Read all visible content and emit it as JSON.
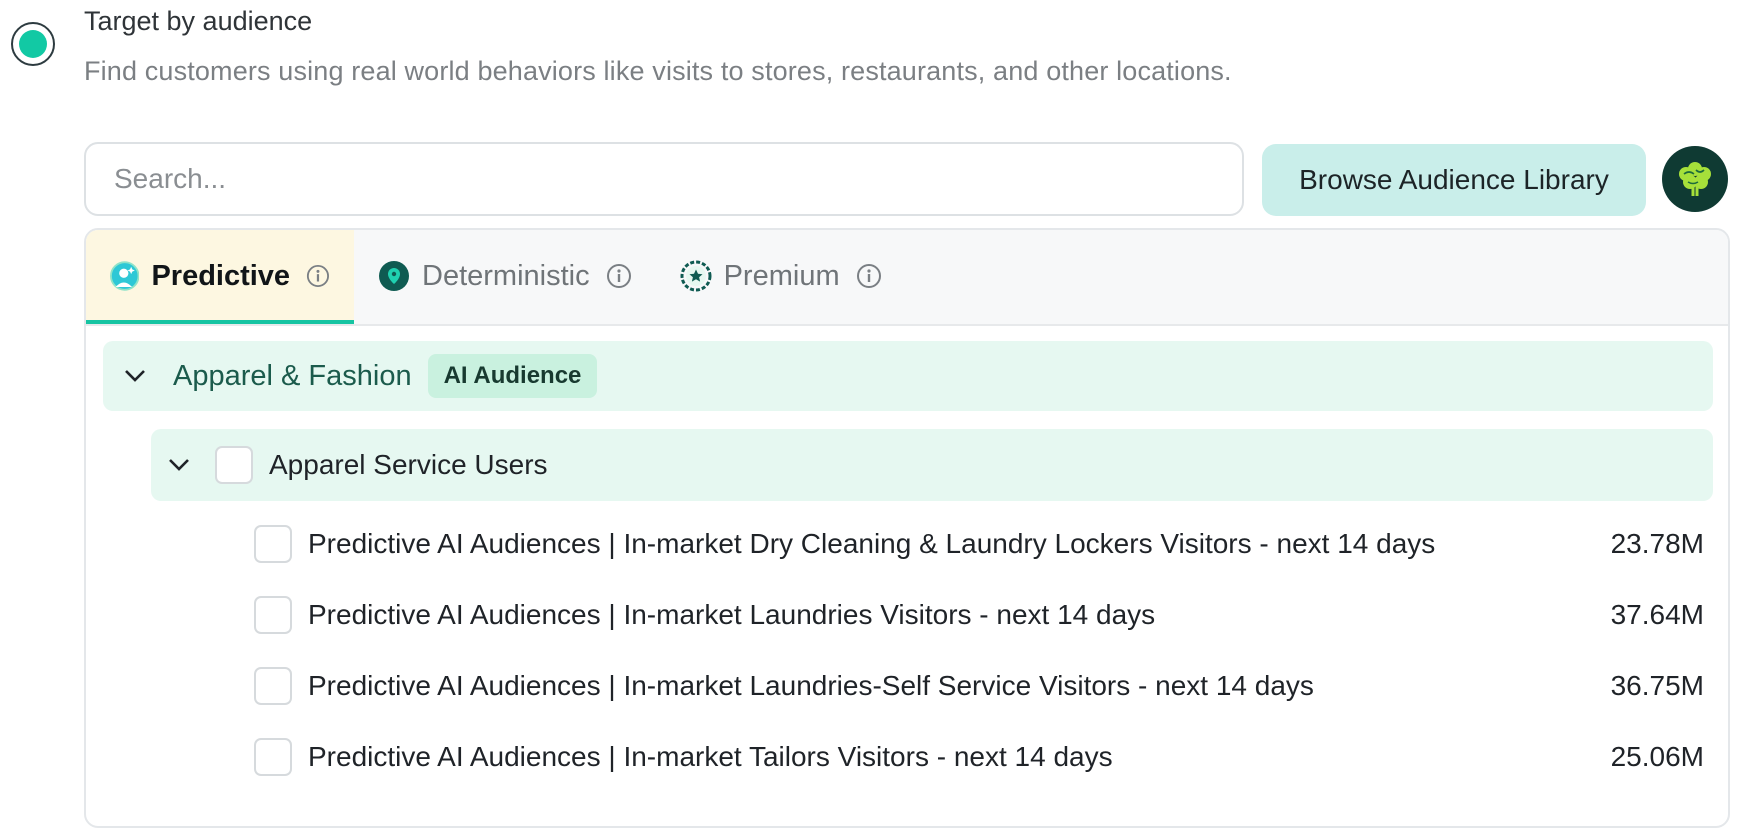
{
  "option": {
    "title": "Target by audience",
    "description": "Find customers using real world behaviors like visits to stores, restaurants, and other locations."
  },
  "search": {
    "placeholder": "Search..."
  },
  "browse_button": {
    "label": "Browse Audience Library"
  },
  "tabs": [
    {
      "label": "Predictive",
      "icon": "predictive-icon",
      "active": true
    },
    {
      "label": "Deterministic",
      "icon": "location-pin-icon",
      "active": false
    },
    {
      "label": "Premium",
      "icon": "star-badge-icon",
      "active": false
    }
  ],
  "category": {
    "label": "Apparel & Fashion",
    "badge": "AI Audience",
    "subcategory": {
      "label": "Apparel Service Users",
      "items": [
        {
          "label": "Predictive AI Audiences | In-market Dry Cleaning & Laundry Lockers Visitors - next 14 days",
          "size": "23.78M"
        },
        {
          "label": "Predictive AI Audiences | In-market Laundries Visitors - next 14 days",
          "size": "37.64M"
        },
        {
          "label": "Predictive AI Audiences | In-market Laundries-Self Service Visitors - next 14 days",
          "size": "36.75M"
        },
        {
          "label": "Predictive AI Audiences | In-market Tailors Visitors - next 14 days",
          "size": "25.06M"
        }
      ]
    }
  },
  "colors": {
    "accent": "#12c9a4",
    "badge_bg": "#c9f1df",
    "row_bg": "#e6f8f1",
    "browse_bg": "#c9eeea"
  }
}
